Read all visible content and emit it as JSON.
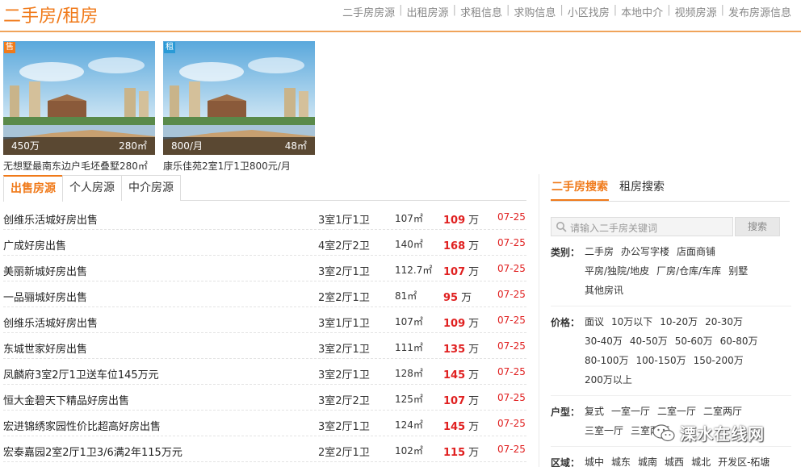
{
  "header": {
    "title": "二手房/租房",
    "nav": [
      "二手房房源",
      "出租房源",
      "求租信息",
      "求购信息",
      "小区找房",
      "本地中介",
      "视频房源",
      "发布房源信息"
    ]
  },
  "featured": [
    {
      "tag": "售",
      "price": "450万",
      "area": "280㎡",
      "caption": "无想墅最南东边户毛坯叠墅280㎡",
      "tag_color": "#f07a1a"
    },
    {
      "tag": "租",
      "price": "800/月",
      "area": "48㎡",
      "caption": "康乐佳苑2室1厅1卫800元/月",
      "tag_color": "#2a9ad6"
    }
  ],
  "tabs": [
    "出售房源",
    "个人房源",
    "中介房源"
  ],
  "listings": [
    {
      "title": "创维乐活城好房出售",
      "layout": "3室1厅1卫",
      "area": "107㎡",
      "price": "109",
      "unit": "万",
      "date": "07-25"
    },
    {
      "title": "广成好房出售",
      "layout": "4室2厅2卫",
      "area": "140㎡",
      "price": "168",
      "unit": "万",
      "date": "07-25"
    },
    {
      "title": "美丽新城好房出售",
      "layout": "3室2厅1卫",
      "area": "112.7㎡",
      "price": "107",
      "unit": "万",
      "date": "07-25"
    },
    {
      "title": "一品骊城好房出售",
      "layout": "2室2厅1卫",
      "area": "81㎡",
      "price": "95",
      "unit": "万",
      "date": "07-25"
    },
    {
      "title": "创维乐活城好房出售",
      "layout": "3室1厅1卫",
      "area": "107㎡",
      "price": "109",
      "unit": "万",
      "date": "07-25"
    },
    {
      "title": "东城世家好房出售",
      "layout": "3室2厅1卫",
      "area": "111㎡",
      "price": "135",
      "unit": "万",
      "date": "07-25"
    },
    {
      "title": "凤麟府3室2厅1卫送车位145万元",
      "layout": "3室2厅1卫",
      "area": "128㎡",
      "price": "145",
      "unit": "万",
      "date": "07-25"
    },
    {
      "title": "恒大金碧天下精品好房出售",
      "layout": "3室2厅2卫",
      "area": "125㎡",
      "price": "107",
      "unit": "万",
      "date": "07-25"
    },
    {
      "title": "宏进锦绣家园性价比超高好房出售",
      "layout": "3室2厅1卫",
      "area": "124㎡",
      "price": "145",
      "unit": "万",
      "date": "07-25"
    },
    {
      "title": "宏泰嘉园2室2厅1卫3/6满2年115万元",
      "layout": "2室2厅1卫",
      "area": "102㎡",
      "price": "115",
      "unit": "万",
      "date": "07-25"
    }
  ],
  "search": {
    "tabs": [
      "二手房搜索",
      "租房搜索"
    ],
    "placeholder": "请输入二手房关键词",
    "button": "搜索"
  },
  "filters": [
    {
      "label": "类别：",
      "options": [
        "二手房",
        "办公写字楼",
        "店面商铺",
        "平房/独院/地皮",
        "厂房/仓库/车库",
        "别墅",
        "其他房讯"
      ]
    },
    {
      "label": "价格：",
      "options": [
        "面议",
        "10万以下",
        "10-20万",
        "20-30万",
        "30-40万",
        "40-50万",
        "50-60万",
        "60-80万",
        "80-100万",
        "100-150万",
        "150-200万",
        "200万以上"
      ]
    },
    {
      "label": "户型：",
      "options": [
        "复式",
        "一室一厅",
        "二室一厅",
        "二室两厅",
        "三室一厅",
        "三室两厅"
      ]
    },
    {
      "label": "区域：",
      "options": [
        "城中",
        "城东",
        "城南",
        "城西",
        "城北",
        "开发区-柘塘"
      ]
    }
  ],
  "watermark": "溧水在线网"
}
